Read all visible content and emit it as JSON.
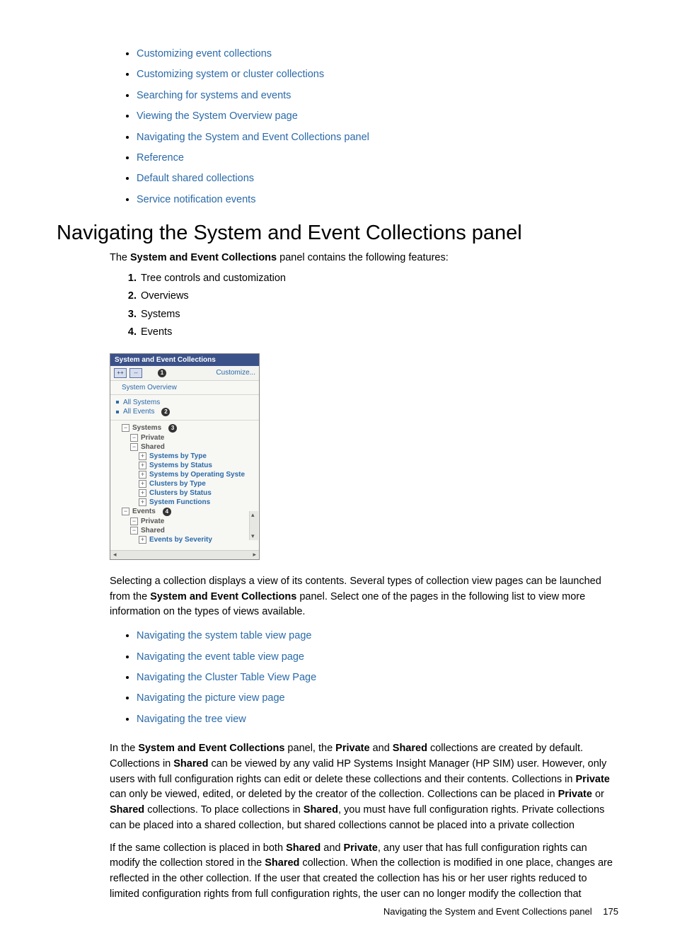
{
  "top_links": [
    "Customizing event collections",
    "Customizing system or cluster collections",
    "Searching for systems and events",
    "Viewing the System Overview page",
    "Navigating the System and Event Collections panel",
    "Reference",
    "Default shared collections",
    "Service notification events"
  ],
  "heading": "Navigating the System and Event Collections panel",
  "intro_1": "The ",
  "intro_bold": "System and Event Collections",
  "intro_2": " panel contains the following features:",
  "numbered": [
    "Tree controls and customization",
    "Overviews",
    "Systems",
    "Events"
  ],
  "figure": {
    "title": "System and Event Collections",
    "customize": "Customize...",
    "callout1": "1",
    "callout2": "2",
    "callout3": "3",
    "callout4": "4",
    "overview": "System Overview",
    "all_systems": "All Systems",
    "all_events": "All Events",
    "systems": "Systems",
    "private": "Private",
    "shared": "Shared",
    "s_type": "Systems by Type",
    "s_status": "Systems by Status",
    "s_os": "Systems by Operating Syste",
    "c_type": "Clusters by Type",
    "c_status": "Clusters by Status",
    "s_func": "System Functions",
    "events": "Events",
    "e_sev": "Events by Severity"
  },
  "para_after_figure_1": "Selecting a collection displays a view of its contents. Several types of collection view pages can be launched from the ",
  "para_after_figure_bold": "System and Event Collections",
  "para_after_figure_2": " panel. Select one of the pages in the following list to view more information on the types of views available.",
  "view_links": [
    "Navigating the system table view page",
    "Navigating the event table view page",
    "Navigating the Cluster Table View Page",
    "Navigating the picture view page",
    "Navigating the tree view"
  ],
  "p3_seg": [
    "In the ",
    "System and Event Collections",
    " panel, the ",
    "Private",
    " and ",
    "Shared",
    " collections are created by default. Collections in ",
    "Shared",
    " can be viewed by any valid HP Systems Insight Manager (HP SIM) user. However, only users with full configuration rights can edit or delete these collections and their contents. Collections in ",
    "Private",
    " can only be viewed, edited, or deleted by the creator of the collection. Collections can be placed in ",
    "Private",
    " or ",
    "Shared",
    " collections. To place collections in ",
    "Shared",
    ", you must have full configuration rights. Private collections can be placed into a shared collection, but shared collections cannot be placed into a private collection"
  ],
  "p4_seg": [
    "If the same collection is placed in both ",
    "Shared",
    " and ",
    "Private",
    ", any user that has full configuration rights can modify the collection stored in the ",
    "Shared",
    " collection. When the collection is modified in one place, changes are reflected in the other collection. If the user that created the collection has his or her user rights reduced to limited configuration rights from full configuration rights, the user can no longer modify the collection that"
  ],
  "footer_text": "Navigating the System and Event Collections panel",
  "footer_page": "175"
}
